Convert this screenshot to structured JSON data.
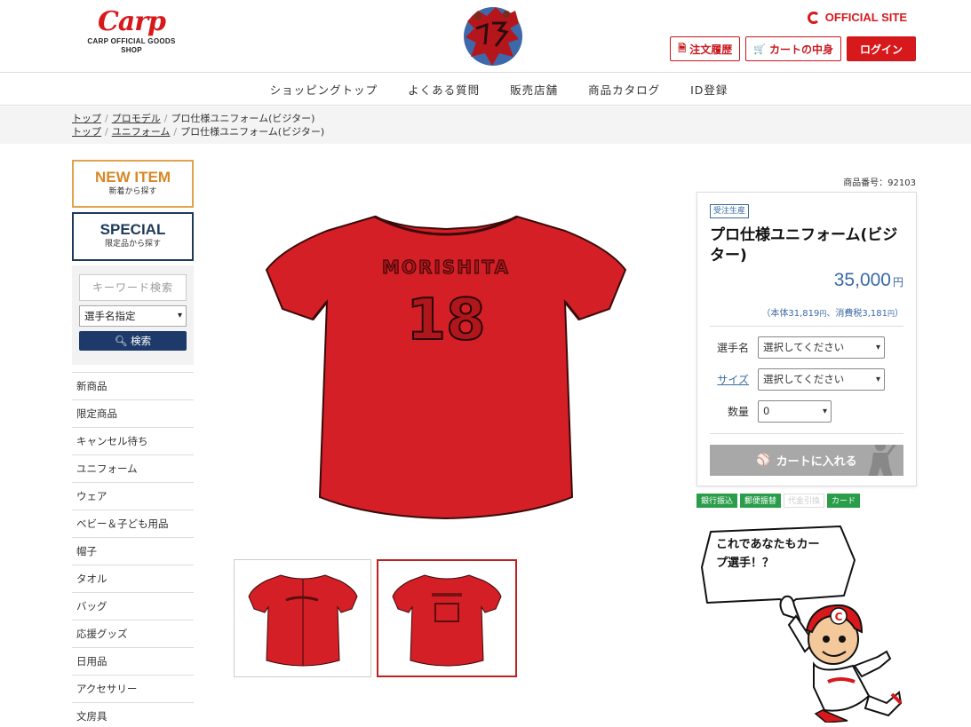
{
  "header": {
    "logo_mark": "Carp",
    "logo_sub_1": "CARP OFFICIAL GOODS",
    "logo_sub_2": "SHOP",
    "official_site": "OFFICIAL SITE",
    "order_history": "注文履歴",
    "cart": "カートの中身",
    "login": "ログイン"
  },
  "nav": [
    "ショッピングトップ",
    "よくある質問",
    "販売店舗",
    "商品カタログ",
    "ID登録"
  ],
  "breadcrumbs": [
    {
      "home": "トップ",
      "cat": "プロモデル",
      "current": "プロ仕様ユニフォーム(ビジター)"
    },
    {
      "home": "トップ",
      "cat": "ユニフォーム",
      "current": "プロ仕様ユニフォーム(ビジター)"
    }
  ],
  "sidebar": {
    "new_item": "NEW ITEM",
    "new_item_sub": "新着から探す",
    "special": "SPECIAL",
    "special_sub": "限定品から探す",
    "keyword_placeholder": "キーワード検索",
    "player_select": "選手名指定",
    "search_button": "検索",
    "categories": [
      "新商品",
      "限定商品",
      "キャンセル待ち",
      "ユニフォーム",
      "ウェア",
      "ベビー＆子ども用品",
      "帽子",
      "タオル",
      "バッグ",
      "応援グッズ",
      "日用品",
      "アクセサリー",
      "文房具"
    ]
  },
  "product": {
    "number_label": "商品番号：92103",
    "tag": "受注生産",
    "name": "プロ仕様ユニフォーム(ビジター)",
    "price": "35,000",
    "price_unit": "円",
    "breakdown_main": "（本体31,819",
    "breakdown_unit1": "円",
    "breakdown_tax": "、消費税3,181",
    "breakdown_unit2": "円",
    "breakdown_close": "）",
    "jersey_name": "MORISHITA",
    "jersey_number": "18",
    "options": {
      "player_label": "選手名",
      "player_value": "選択してください",
      "size_label": "サイズ",
      "size_value": "選択してください",
      "qty_label": "数量",
      "qty_value": "0"
    },
    "cart_button": "カートに入れる",
    "payments": [
      {
        "label": "銀行振込",
        "enabled": true
      },
      {
        "label": "郵便振替",
        "enabled": true
      },
      {
        "label": "代金引換",
        "enabled": false
      },
      {
        "label": "カード",
        "enabled": true
      }
    ]
  },
  "mascot": {
    "bubble_line1": "これであなたもカー",
    "bubble_line2": "プ選手！？"
  },
  "colors": {
    "brand_red": "#d7191b",
    "navy": "#1d3a6a",
    "price_blue": "#3a6aa8",
    "pay_green": "#2a9d4a"
  }
}
